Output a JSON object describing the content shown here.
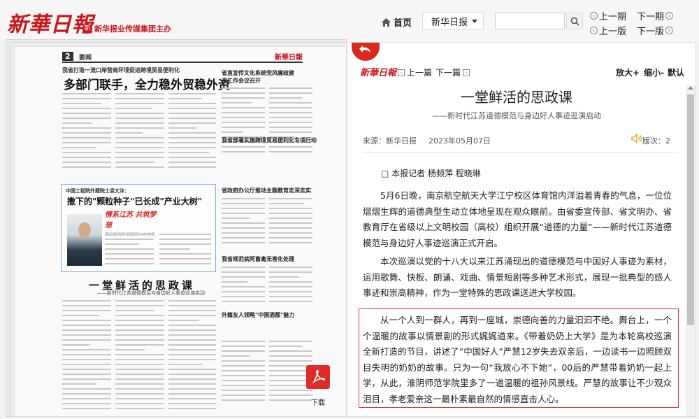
{
  "header": {
    "logo_text": "新華日報",
    "host_mark": "新",
    "host_text": "新华报业传媒集团主办",
    "home_label": "首页",
    "paper_select_value": "新华日报",
    "search_placeholder": "",
    "nav": {
      "prev_issue": "上一期",
      "next_issue": "下一期",
      "prev_page": "上一版",
      "next_page": "下一版"
    }
  },
  "newspaper_page": {
    "page_number": "2",
    "section": "要闻",
    "masthead": "新華日報",
    "kicker": "我省打造一流口岸营商环境促进跨境贸易便利化",
    "headline": "多部门联手，全力稳外贸稳外资",
    "right_head_1": "省直宣传文化系统党风廉政建设工作会议召开",
    "right_head_2": "我省部署实施跨境贸易便利化专项行动",
    "right_head_3": "省政府办公厅推动主题教育走深走实",
    "right_head_4": "我省规范病死畜禽无害化处理",
    "box_kicker": "中国工程院外籍院士袁文沐：",
    "box_headline": "撒下的\"颗粒种子\"已长成\"产业大树\"",
    "box_banner_title": "情系江苏 共筑梦想",
    "box_banner_sub": "第三届海外高层次人才大会",
    "mid_headline": "一堂鲜活的思政课",
    "mid_subhead": "——新时代江苏道德模范与身边好人事迹巡演启动",
    "right_box_text": "外籍友人领略\"中国酒都\"魅力",
    "download_label": "下载"
  },
  "article": {
    "toolbar": {
      "logo_text": "新華日報",
      "prev_label": "上一篇",
      "next_label": "下一篇",
      "zoom_in": "放大+",
      "zoom_out": "缩小-",
      "default": "默认"
    },
    "title": "一堂鲜活的思政课",
    "subtitle": "——新时代江苏道德模范与身边好人事迹巡演启动",
    "source": "来源：新华日报",
    "date": "2023年05月07日",
    "edition": "版次：2",
    "byline": "□ 本报记者 杨频萍 程晓琳",
    "paragraphs": [
      "5月6日晚，南京航空航天大学江宁校区体育馆内洋溢着青春的气息，一位位熠熠生辉的道德典型生动立体地呈现在观众眼前。由省委宣传部、省文明办、省教育厅在省级以上文明校园（高校）组织开展“道德的力量”——新时代江苏道德模范与身边好人事迹巡演正式开启。",
      "本次巡演以党的十八大以来江苏涌现出的道德模范与中国好人事迹为素材，运用歌舞、快板、朗诵、戏曲、情景短剧等多种艺术形式，展现一批典型的感人事迹和崇高精神，作为一堂特殊的思政课送进大学校园。",
      "从一个人到一群人，再到一座城，崇德向善的力量汩汩不绝。舞台上，一个个温暖的故事以情景剧的形式娓娓道来。《带着奶奶上大学》是为本轮高校巡演全新打造的节目，讲述了“中国好人”严慧12岁失去双亲后，一边读书一边照顾双目失明的奶奶的故事。只为一句“我放心不下她”，00后的严慧带着奶奶一起上学，从此，淮阴师范学院里多了一道温暖的祖孙风景线。严慧的故事让不少观众泪目，孝老爱亲这一最朴素最自然的情感直击人心。"
    ]
  },
  "colors": {
    "brand_red": "#c8161d",
    "highlight_border": "#e03030",
    "pdf_red": "#e02b2b"
  },
  "icons": [
    "home-icon",
    "chevron-down-icon",
    "search-icon",
    "prev-circle-icon",
    "next-circle-icon",
    "back-arrow-icon",
    "pdf-icon",
    "prev-square-icon",
    "speaker-icon"
  ]
}
